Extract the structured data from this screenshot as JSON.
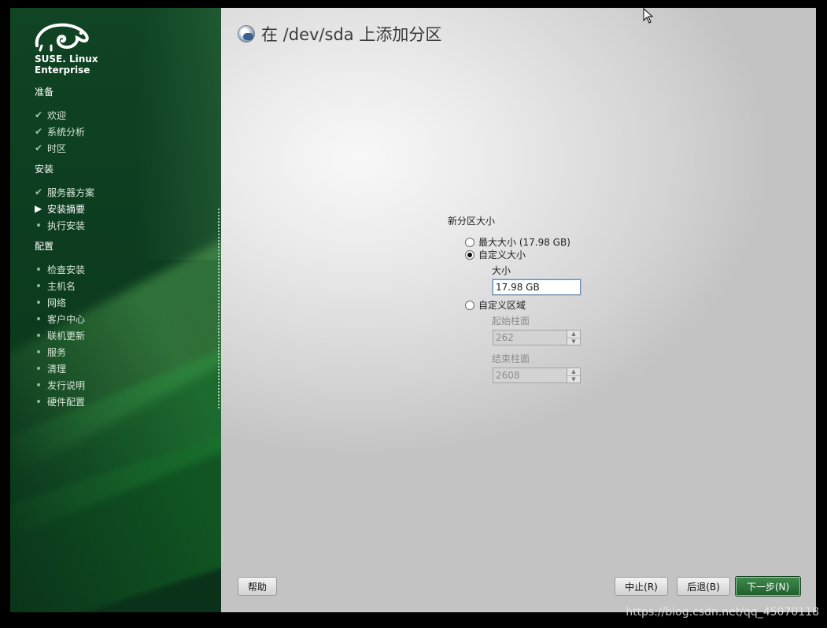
{
  "sidebar": {
    "logo_line1": "SUSE. Linux",
    "logo_line2": "Enterprise",
    "sections": [
      {
        "title": "准备"
      },
      {
        "title": "安装"
      },
      {
        "title": "配置"
      }
    ],
    "prep_items": [
      "欢迎",
      "系统分析",
      "时区"
    ],
    "install_items": [
      "服务器方案",
      "安装摘要",
      "执行安装"
    ],
    "config_items": [
      "检查安装",
      "主机名",
      "网络",
      "客户中心",
      "联机更新",
      "服务",
      "清理",
      "发行说明",
      "硬件配置"
    ]
  },
  "main": {
    "title": "在 /dev/sda 上添加分区",
    "form_title": "新分区大小",
    "option_max": "最大大小 (17.98 GB)",
    "option_custom_size": "自定义大小",
    "size_label": "大小",
    "size_value": "17.98 GB",
    "option_custom_region": "自定义区域",
    "start_label": "起始柱面",
    "start_value": "262",
    "end_label": "结束柱面",
    "end_value": "2608",
    "selected_option": "自定义大小"
  },
  "buttons": {
    "help": "帮助",
    "abort": "中止(R)",
    "back": "后退(B)",
    "next": "下一步(N)"
  },
  "watermark": "https://blog.csdn.net/qq_45070118"
}
